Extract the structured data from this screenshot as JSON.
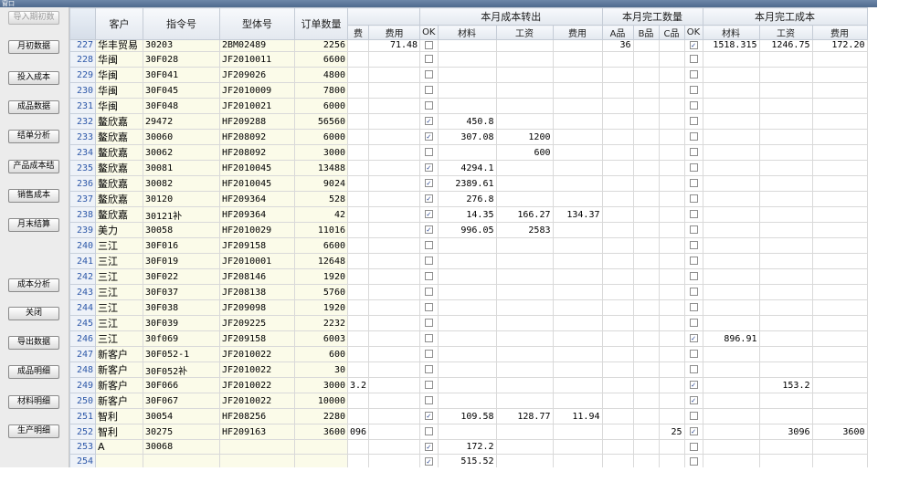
{
  "window": {
    "title": "窗口"
  },
  "sidebar": {
    "buttons": [
      {
        "label": "导入期初数",
        "top": 0,
        "disabled": true
      },
      {
        "label": "月初数据"
      },
      {
        "label": "投入成本"
      },
      {
        "label": "成品数据"
      },
      {
        "label": "结单分析"
      },
      {
        "label": "产品成本结"
      },
      {
        "label": "销售成本"
      },
      {
        "label": "月末结算"
      },
      {
        "label": "成本分析"
      },
      {
        "label": "关闭"
      },
      {
        "label": "导出数据"
      },
      {
        "label": "成品明细"
      },
      {
        "label": "材料明细"
      },
      {
        "label": "生产明细"
      }
    ]
  },
  "grid": {
    "headers": {
      "customer": "客户",
      "order_no": "指令号",
      "model_no": "型体号",
      "qty": "订单数量",
      "group_transfer": "本月成本转出",
      "group_done_qty": "本月完工数量",
      "group_done_cost": "本月完工成本",
      "sub_fee0": "费",
      "sub_fee1": "费用",
      "sub_ok1": "OK",
      "sub_mat1": "材料",
      "sub_wage1": "工资",
      "sub_fee2": "费用",
      "sub_a": "A品",
      "sub_b": "B品",
      "sub_c": "C品",
      "sub_ok2": "OK",
      "sub_mat2": "材料",
      "sub_wage2": "工资",
      "sub_fee3": "费用"
    },
    "rows": [
      {
        "n": "227",
        "cust": "华丰贸易",
        "order": "30203",
        "model": "2BM02489",
        "qty": "2256",
        "fee0": "",
        "fee1": "71.48",
        "ok1": false,
        "mat1": "",
        "wage1": "",
        "fee2": "",
        "a": "36",
        "b": "",
        "c": "",
        "ok2": true,
        "mat2": "1518.315",
        "wage2": "1246.75",
        "fee3": "172.20"
      },
      {
        "n": "228",
        "cust": "华闽",
        "order": "30F028",
        "model": "JF2010011",
        "qty": "6600",
        "fee0": "",
        "fee1": "",
        "ok1": false,
        "mat1": "",
        "wage1": "",
        "fee2": "",
        "a": "",
        "b": "",
        "c": "",
        "ok2": false,
        "mat2": "",
        "wage2": "",
        "fee3": ""
      },
      {
        "n": "229",
        "cust": "华闽",
        "order": "30F041",
        "model": "JF209026",
        "qty": "4800",
        "fee0": "",
        "fee1": "",
        "ok1": false,
        "mat1": "",
        "wage1": "",
        "fee2": "",
        "a": "",
        "b": "",
        "c": "",
        "ok2": false,
        "mat2": "",
        "wage2": "",
        "fee3": ""
      },
      {
        "n": "230",
        "cust": "华闽",
        "order": "30F045",
        "model": "JF2010009",
        "qty": "7800",
        "fee0": "",
        "fee1": "",
        "ok1": false,
        "mat1": "",
        "wage1": "",
        "fee2": "",
        "a": "",
        "b": "",
        "c": "",
        "ok2": false,
        "mat2": "",
        "wage2": "",
        "fee3": ""
      },
      {
        "n": "231",
        "cust": "华闽",
        "order": "30F048",
        "model": "JF2010021",
        "qty": "6000",
        "fee0": "",
        "fee1": "",
        "ok1": false,
        "mat1": "",
        "wage1": "",
        "fee2": "",
        "a": "",
        "b": "",
        "c": "",
        "ok2": false,
        "mat2": "",
        "wage2": "",
        "fee3": ""
      },
      {
        "n": "232",
        "cust": "鳌欣嘉",
        "order": "29472",
        "model": "HF209288",
        "qty": "56560",
        "fee0": "",
        "fee1": "",
        "ok1": true,
        "mat1": "450.8",
        "wage1": "",
        "fee2": "",
        "a": "",
        "b": "",
        "c": "",
        "ok2": false,
        "mat2": "",
        "wage2": "",
        "fee3": ""
      },
      {
        "n": "233",
        "cust": "鳌欣嘉",
        "order": "30060",
        "model": "HF208092",
        "qty": "6000",
        "fee0": "",
        "fee1": "",
        "ok1": true,
        "mat1": "307.08",
        "wage1": "1200",
        "fee2": "",
        "a": "",
        "b": "",
        "c": "",
        "ok2": false,
        "mat2": "",
        "wage2": "",
        "fee3": ""
      },
      {
        "n": "234",
        "cust": "鳌欣嘉",
        "order": "30062",
        "model": "HF208092",
        "qty": "3000",
        "fee0": "",
        "fee1": "",
        "ok1": false,
        "mat1": "",
        "wage1": "600",
        "fee2": "",
        "a": "",
        "b": "",
        "c": "",
        "ok2": false,
        "mat2": "",
        "wage2": "",
        "fee3": ""
      },
      {
        "n": "235",
        "cust": "鳌欣嘉",
        "order": "30081",
        "model": "HF2010045",
        "qty": "13488",
        "fee0": "",
        "fee1": "",
        "ok1": true,
        "mat1": "4294.1",
        "wage1": "",
        "fee2": "",
        "a": "",
        "b": "",
        "c": "",
        "ok2": false,
        "mat2": "",
        "wage2": "",
        "fee3": ""
      },
      {
        "n": "236",
        "cust": "鳌欣嘉",
        "order": "30082",
        "model": "HF2010045",
        "qty": "9024",
        "fee0": "",
        "fee1": "",
        "ok1": true,
        "mat1": "2389.61",
        "wage1": "",
        "fee2": "",
        "a": "",
        "b": "",
        "c": "",
        "ok2": false,
        "mat2": "",
        "wage2": "",
        "fee3": ""
      },
      {
        "n": "237",
        "cust": "鳌欣嘉",
        "order": "30120",
        "model": "HF209364",
        "qty": "528",
        "fee0": "",
        "fee1": "",
        "ok1": true,
        "mat1": "276.8",
        "wage1": "",
        "fee2": "",
        "a": "",
        "b": "",
        "c": "",
        "ok2": false,
        "mat2": "",
        "wage2": "",
        "fee3": ""
      },
      {
        "n": "238",
        "cust": "鳌欣嘉",
        "order": "30121补",
        "model": "HF209364",
        "qty": "42",
        "fee0": "",
        "fee1": "",
        "ok1": true,
        "mat1": "14.35",
        "wage1": "166.27",
        "fee2": "134.37",
        "a": "",
        "b": "",
        "c": "",
        "ok2": false,
        "mat2": "",
        "wage2": "",
        "fee3": ""
      },
      {
        "n": "239",
        "cust": "美力",
        "order": "30058",
        "model": "HF2010029",
        "qty": "11016",
        "fee0": "",
        "fee1": "",
        "ok1": true,
        "mat1": "996.05",
        "wage1": "2583",
        "fee2": "",
        "a": "",
        "b": "",
        "c": "",
        "ok2": false,
        "mat2": "",
        "wage2": "",
        "fee3": ""
      },
      {
        "n": "240",
        "cust": "三江",
        "order": "30F016",
        "model": "JF209158",
        "qty": "6600",
        "fee0": "",
        "fee1": "",
        "ok1": false,
        "mat1": "",
        "wage1": "",
        "fee2": "",
        "a": "",
        "b": "",
        "c": "",
        "ok2": false,
        "mat2": "",
        "wage2": "",
        "fee3": ""
      },
      {
        "n": "241",
        "cust": "三江",
        "order": "30F019",
        "model": "JF2010001",
        "qty": "12648",
        "fee0": "",
        "fee1": "",
        "ok1": false,
        "mat1": "",
        "wage1": "",
        "fee2": "",
        "a": "",
        "b": "",
        "c": "",
        "ok2": false,
        "mat2": "",
        "wage2": "",
        "fee3": ""
      },
      {
        "n": "242",
        "cust": "三江",
        "order": "30F022",
        "model": "JF208146",
        "qty": "1920",
        "fee0": "",
        "fee1": "",
        "ok1": false,
        "mat1": "",
        "wage1": "",
        "fee2": "",
        "a": "",
        "b": "",
        "c": "",
        "ok2": false,
        "mat2": "",
        "wage2": "",
        "fee3": ""
      },
      {
        "n": "243",
        "cust": "三江",
        "order": "30F037",
        "model": "JF208138",
        "qty": "5760",
        "fee0": "",
        "fee1": "",
        "ok1": false,
        "mat1": "",
        "wage1": "",
        "fee2": "",
        "a": "",
        "b": "",
        "c": "",
        "ok2": false,
        "mat2": "",
        "wage2": "",
        "fee3": ""
      },
      {
        "n": "244",
        "cust": "三江",
        "order": "30F038",
        "model": "JF209098",
        "qty": "1920",
        "fee0": "",
        "fee1": "",
        "ok1": false,
        "mat1": "",
        "wage1": "",
        "fee2": "",
        "a": "",
        "b": "",
        "c": "",
        "ok2": false,
        "mat2": "",
        "wage2": "",
        "fee3": ""
      },
      {
        "n": "245",
        "cust": "三江",
        "order": "30F039",
        "model": "JF209225",
        "qty": "2232",
        "fee0": "",
        "fee1": "",
        "ok1": false,
        "mat1": "",
        "wage1": "",
        "fee2": "",
        "a": "",
        "b": "",
        "c": "",
        "ok2": false,
        "mat2": "",
        "wage2": "",
        "fee3": ""
      },
      {
        "n": "246",
        "cust": "三江",
        "order": "30f069",
        "model": "JF209158",
        "qty": "6003",
        "fee0": "",
        "fee1": "",
        "ok1": false,
        "mat1": "",
        "wage1": "",
        "fee2": "",
        "a": "",
        "b": "",
        "c": "",
        "ok2": true,
        "mat2": "896.91",
        "wage2": "",
        "fee3": ""
      },
      {
        "n": "247",
        "cust": "新客户",
        "order": "30F052-1",
        "model": "JF2010022",
        "qty": "600",
        "fee0": "",
        "fee1": "",
        "ok1": false,
        "mat1": "",
        "wage1": "",
        "fee2": "",
        "a": "",
        "b": "",
        "c": "",
        "ok2": false,
        "mat2": "",
        "wage2": "",
        "fee3": ""
      },
      {
        "n": "248",
        "cust": "新客户",
        "order": "30F052补",
        "model": "JF2010022",
        "qty": "30",
        "fee0": "",
        "fee1": "",
        "ok1": false,
        "mat1": "",
        "wage1": "",
        "fee2": "",
        "a": "",
        "b": "",
        "c": "",
        "ok2": false,
        "mat2": "",
        "wage2": "",
        "fee3": ""
      },
      {
        "n": "249",
        "cust": "新客户",
        "order": "30F066",
        "model": "JF2010022",
        "qty": "3000",
        "fee0": "3.2",
        "fee1": "",
        "ok1": false,
        "mat1": "",
        "wage1": "",
        "fee2": "",
        "a": "",
        "b": "",
        "c": "",
        "ok2": true,
        "mat2": "",
        "wage2": "153.2",
        "fee3": ""
      },
      {
        "n": "250",
        "cust": "新客户",
        "order": "30F067",
        "model": "JF2010022",
        "qty": "10000",
        "fee0": "",
        "fee1": "",
        "ok1": false,
        "mat1": "",
        "wage1": "",
        "fee2": "",
        "a": "",
        "b": "",
        "c": "",
        "ok2": true,
        "mat2": "",
        "wage2": "",
        "fee3": ""
      },
      {
        "n": "251",
        "cust": "智利",
        "order": "30054",
        "model": "HF208256",
        "qty": "2280",
        "fee0": "",
        "fee1": "",
        "ok1": true,
        "mat1": "109.58",
        "wage1": "128.77",
        "fee2": "11.94",
        "a": "",
        "b": "",
        "c": "",
        "ok2": false,
        "mat2": "",
        "wage2": "",
        "fee3": ""
      },
      {
        "n": "252",
        "cust": "智利",
        "order": "30275",
        "model": "HF209163",
        "qty": "3600",
        "fee0": "096",
        "fee1": "",
        "ok1": false,
        "mat1": "",
        "wage1": "",
        "fee2": "",
        "a": "",
        "b": "",
        "c": "25",
        "ok2": true,
        "mat2": "",
        "wage2": "3096",
        "fee3": "3600"
      },
      {
        "n": "253",
        "cust": "A",
        "order": "30068",
        "model": "",
        "qty": "",
        "fee0": "",
        "fee1": "",
        "ok1": true,
        "mat1": "172.2",
        "wage1": "",
        "fee2": "",
        "a": "",
        "b": "",
        "c": "",
        "ok2": false,
        "mat2": "",
        "wage2": "",
        "fee3": ""
      },
      {
        "n": "254",
        "cust": "",
        "order": "",
        "model": "",
        "qty": "",
        "fee0": "",
        "fee1": "",
        "ok1": true,
        "mat1": "515.52",
        "wage1": "",
        "fee2": "",
        "a": "",
        "b": "",
        "c": "",
        "ok2": false,
        "mat2": "",
        "wage2": "",
        "fee3": ""
      }
    ]
  }
}
